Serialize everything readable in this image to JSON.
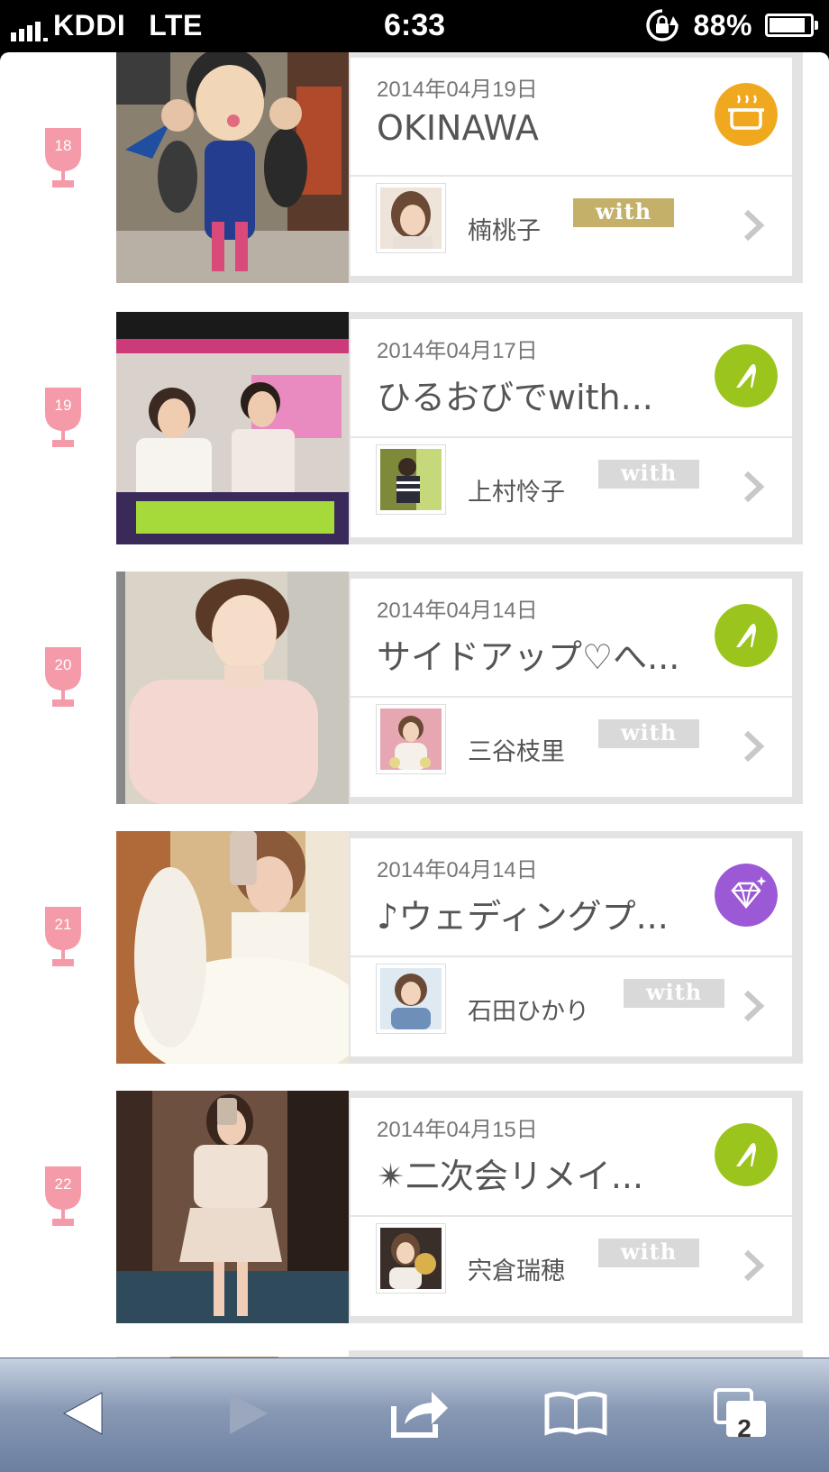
{
  "status_bar": {
    "carrier": "KDDI",
    "network": "LTE",
    "time": "6:33",
    "battery": "88%",
    "battery_level": 0.88
  },
  "items": [
    {
      "rank": "18",
      "date": "2014年04月19日",
      "title": "OKINAWA",
      "author": "楠桃子",
      "tag": "with",
      "category_icon": "pot-icon",
      "category_color": "#f0a91e",
      "tag_color": "#c5b06a"
    },
    {
      "rank": "19",
      "date": "2014年04月17日",
      "title": "ひるおびでwith...",
      "author": "上村怜子",
      "tag": "with",
      "category_icon": "high-heel-icon",
      "category_color": "#9bc41c",
      "tag_color": "#d9d9d9"
    },
    {
      "rank": "20",
      "date": "2014年04月14日",
      "title": "サイドアップ♡へ...",
      "author": "三谷枝里",
      "tag": "with",
      "category_icon": "high-heel-icon",
      "category_color": "#9bc41c",
      "tag_color": "#d9d9d9"
    },
    {
      "rank": "21",
      "date": "2014年04月14日",
      "title": "♪ウェディングプ...",
      "author": "石田ひかり",
      "tag": "with",
      "category_icon": "diamond-icon",
      "category_color": "#9b59d6",
      "tag_color": "#d9d9d9"
    },
    {
      "rank": "22",
      "date": "2014年04月15日",
      "title": "✴二次会リメイ...",
      "author": "宍倉瑞穂",
      "tag": "with",
      "category_icon": "high-heel-icon",
      "category_color": "#9bc41c",
      "tag_color": "#d9d9d9"
    }
  ],
  "toolbar": {
    "back": "back-arrow-icon",
    "forward": "forward-arrow-icon",
    "share": "share-icon",
    "bookmarks": "bookmarks-icon",
    "tabs": "tabs-icon",
    "tab_count": "2"
  }
}
